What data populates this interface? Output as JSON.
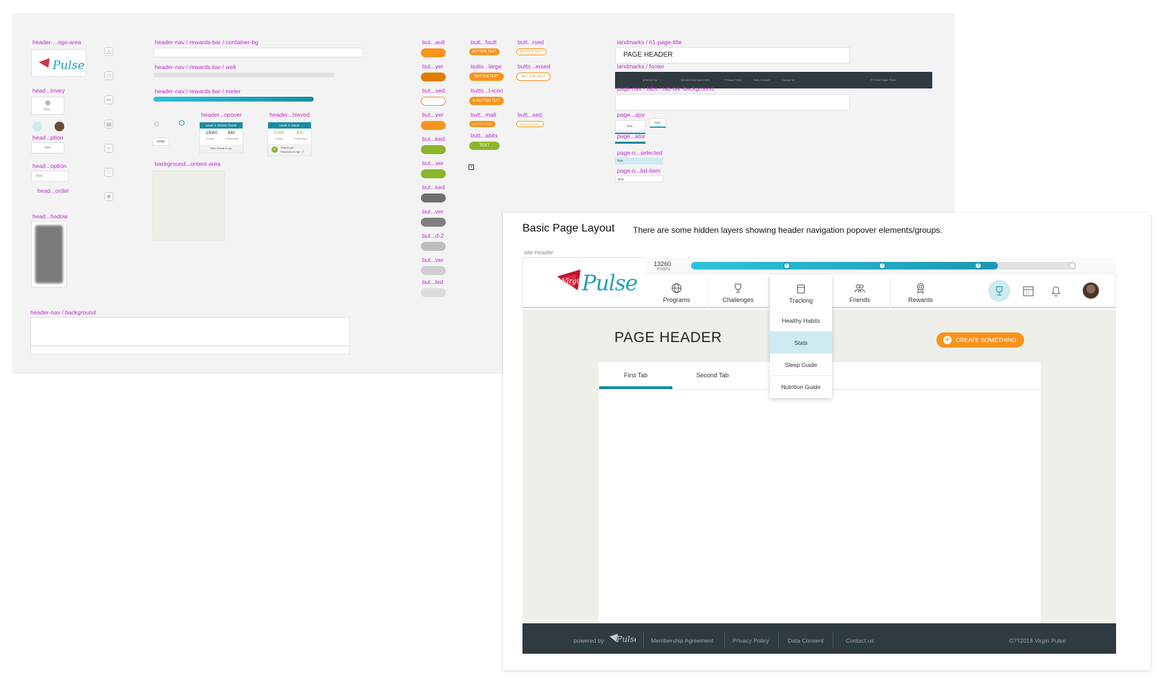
{
  "colors": {
    "label": "#c02bd0",
    "orange": "#f7941d",
    "teal": "#1fa0b8",
    "green": "#8cb529",
    "dark_footer": "#2f3b41",
    "light_teal": "#cfeaf1"
  },
  "icons": [
    "bell-icon",
    "calendar-icon",
    "friends-icon",
    "tracking-icon",
    "rewards-icon",
    "trophy-icon",
    "globe-icon",
    "plus-circle-icon",
    "check-icon"
  ],
  "symbols": {
    "labels": {
      "logo_area": "header-...ogo-area",
      "primary": "head...imary",
      "caption": "head...ption",
      "option": "head...option",
      "border": "head...order",
      "shadow": "head...hadow",
      "rb_container": "header-nav / rewards-bar / container-bg",
      "rb_well": "header-nav / rewards-bar / well",
      "rb_meter": "header-nav / rewards-bar / meter",
      "popover": "header...opover",
      "achieved": "header...hieved",
      "bg_content": "background...ontent-area",
      "nav_bg": "header-nav / background",
      "btn_col1": [
        "but...ault",
        "but...ver",
        "but...sed",
        "but...ver",
        "but...ked",
        "but...ver",
        "but...ked",
        "but...ver",
        "but...d-2",
        "but...ver",
        "but...led"
      ],
      "btn_col2": [
        "butt...fault",
        "butto...large",
        "butto...t-icon",
        "butt...mall",
        "butt...abits"
      ],
      "btn_col3": [
        "butt...rsed",
        "butto...ersed",
        "butt...sed"
      ],
      "lm_title": "landmarks / h1-page-title",
      "lm_footer": "landmarks / footer",
      "tabbar_bg": "page-nav / tabs / tab-bar-background",
      "page_major": "page...ajor",
      "page_ator": "page...ator",
      "page_selected": "page-n...selected",
      "page_list": "page-n...list-item"
    },
    "small_text": "Text",
    "button_text": "BUTTON TEXT",
    "text_btn": "TEXT",
    "page_header_sample": "PAGE HEADER",
    "points_small": "13260",
    "popover_card": {
      "title": "Level 4: Almost There!",
      "pts": "15000",
      "pts_unit": "Points",
      "amt": "$40",
      "amt_unit": "PulseCash",
      "footer": "1500 Points to go!"
    },
    "achieved_card": {
      "title": "Level 3: Done!",
      "pts": "11000",
      "pts_unit": "Points",
      "amt": "$30",
      "amt_unit": "PulseCash",
      "msg1": "Way to go!",
      "msg2": "Reached on Apr 17"
    },
    "footer_mini": [
      "powered by",
      "Membership Agreement",
      "Privacy Policy",
      "Data Consent",
      "Contact us",
      "©?2018 Virgin Pulse"
    ]
  },
  "layout": {
    "title": "Basic Page Layout",
    "description": "There are some hidden layers showing header navigation popover elements/groups.",
    "site_header_label": "site-header",
    "logo_text": "Pulse",
    "logo_prefix": "Virgin",
    "points_value": "13260",
    "points_unit": "POINTS",
    "progress_fraction": 0.8,
    "milestones": [
      "1",
      "2",
      "3",
      ""
    ],
    "nav": [
      {
        "label": "Programs",
        "icon": "globe-icon"
      },
      {
        "label": "Challenges",
        "icon": "trophy-icon"
      },
      {
        "label": "Tracking",
        "icon": "tracking-icon"
      },
      {
        "label": "Friends",
        "icon": "friends-icon"
      },
      {
        "label": "Rewards",
        "icon": "rewards-icon"
      }
    ],
    "dropdown": [
      "Healthy Habits",
      "Stats",
      "Sleep Guide",
      "Nutrition Guide"
    ],
    "dropdown_selected": "Stats",
    "page_header": "PAGE HEADER",
    "create_button": "CREATE SOMETHING",
    "tabs": [
      "First Tab",
      "Second Tab"
    ],
    "active_tab": "First Tab",
    "footer": {
      "powered_by": "powered by",
      "links": [
        "Membership Agreement",
        "Privacy Policy",
        "Data Consent",
        "Contact us"
      ],
      "copyright": "©??2018 Virgin Pulse"
    }
  }
}
